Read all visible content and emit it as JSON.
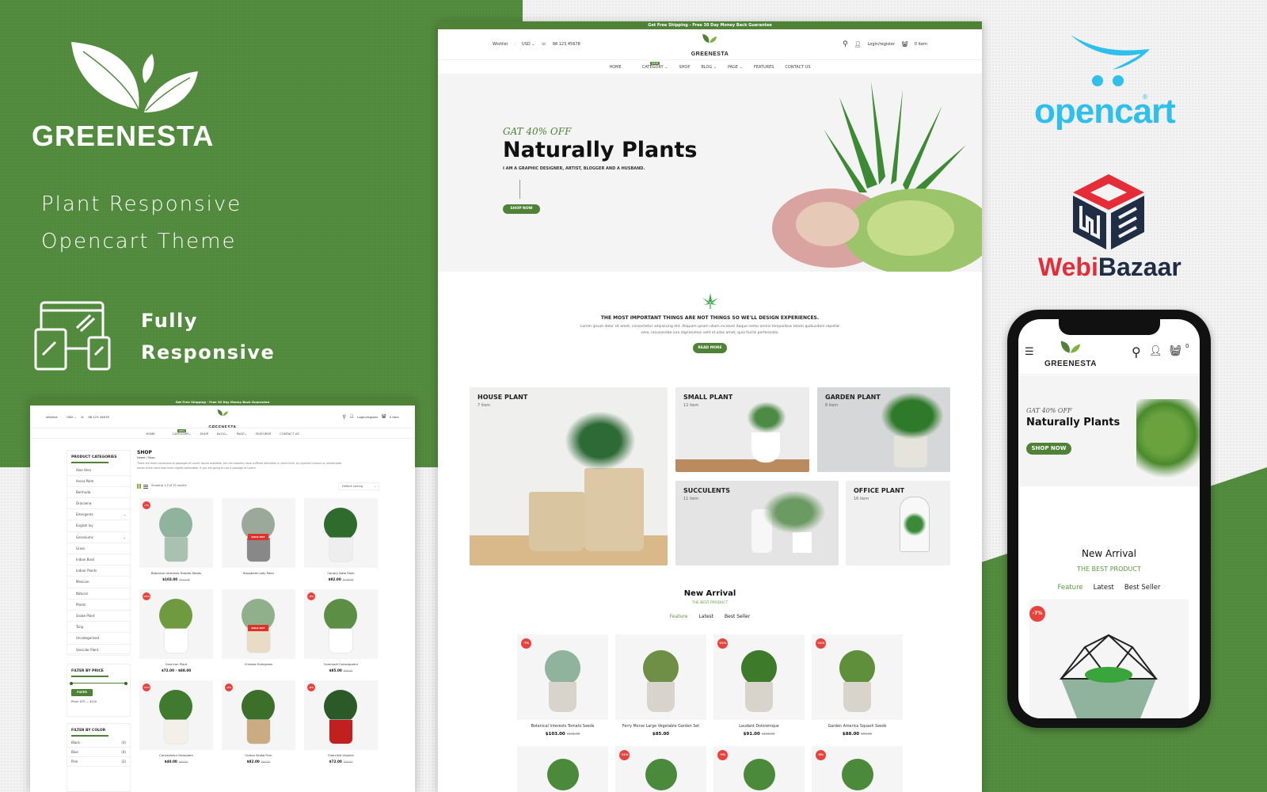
{
  "colors": {
    "brand_green": "#548c3f",
    "accent_green": "#4f8236",
    "discount_red": "#e8423c",
    "opencart_blue": "#2ebfec",
    "webibazaar_red": "#e52d3a",
    "webibazaar_navy": "#1f2d45"
  },
  "promo": {
    "brand_name": "GREENESTA",
    "tagline_line1": "Plant Responsive",
    "tagline_line2": "Opencart Theme",
    "feature_line1": "Fully",
    "feature_line2": "Responsive",
    "feature_icon": "responsive-devices-icon"
  },
  "partners": {
    "opencart_label": "opencart",
    "opencart_reg": "®",
    "webibazaar_part1": "Webi",
    "webibazaar_part2": "Bazaar"
  },
  "desktop": {
    "promo_bar": "Get Free Shipping - Free 30 Day Money Back Guarantee",
    "header": {
      "wishlist": "Wishlist",
      "currency": "USD",
      "phone": "98 123 45678",
      "logo": "GREENESTA",
      "login": "Login/register",
      "cart": "0 item"
    },
    "nav": [
      {
        "label": "HOME"
      },
      {
        "label": "CATEGORY",
        "dropdown": true,
        "badge": "NEW"
      },
      {
        "label": "SHOP"
      },
      {
        "label": "BLOG",
        "dropdown": true
      },
      {
        "label": "PAGE",
        "dropdown": true
      },
      {
        "label": "FEATURES"
      },
      {
        "label": "CONTACT US"
      }
    ],
    "hero": {
      "kicker": "GAT 40% OFF",
      "title": "Naturally Plants",
      "subtitle": "I AM A GRAPHIC DESIGNER, ARTIST, BLOGGER AND A HUSBAND.",
      "button": "SHOP NOW"
    },
    "about": {
      "heading": "THE MOST IMPORTANT THINGS ARE NOT THINGS SO WE'LL DESIGN EXPERIENCES.",
      "text_line1": "Lorem ipsum dolor sit amet, consectetur adipisicing elit. Aliquam ipsam ullam incidunt itaque nemo omnis temporibus totam quibusdam repellat",
      "text_line2": "vero, recusandae iure dignissimos velit et alias amet, quia facilis perferendis.",
      "button": "READ MORE"
    },
    "categories": [
      {
        "name": "HOUSE PLANT",
        "count": "7 item"
      },
      {
        "name": "SMALL PLANT",
        "count": "12 item"
      },
      {
        "name": "GARDEN PLANT",
        "count": "8 item"
      },
      {
        "name": "SUCCULENTS",
        "count": "11 item"
      },
      {
        "name": "OFFICE PLANT",
        "count": "16 item"
      }
    ],
    "new_arrival": {
      "title": "New Arrival",
      "subtitle": "THE BEST PRODUCT",
      "tabs": [
        {
          "label": "Feature",
          "active": true
        },
        {
          "label": "Latest"
        },
        {
          "label": "Best Seller"
        }
      ],
      "products": [
        {
          "name": "Botanical Interests Tomato Seeds",
          "price": "$103.00",
          "old_price": "$111.00",
          "discount": "-7%"
        },
        {
          "name": "Ferry Morse Large Vegetable Garden Set",
          "price": "$85.00",
          "old_price": "",
          "discount": ""
        },
        {
          "name": "Laudant Doloremque",
          "price": "$91.00",
          "old_price": "$116.00",
          "discount": "-21%"
        },
        {
          "name": "Garden America Squash Seeds",
          "price": "$88.00",
          "old_price": "$99.00",
          "discount": "-11%"
        }
      ],
      "row2_discounts": [
        "",
        "-11%",
        "-9%",
        "-6%"
      ]
    }
  },
  "shop_screen": {
    "promo_bar": "Get Free Shipping - Free 30 Day Money Back Guarantee",
    "header": {
      "wishlist": "Wishlist",
      "currency": "USD",
      "phone": "98 123 45678",
      "logo": "GREENESTA",
      "login": "Login/register",
      "cart": "0 item"
    },
    "nav": [
      "HOME",
      "CATEGORY",
      "SHOP",
      "BLOG",
      "PAGE",
      "FEATURES",
      "CONTACT US"
    ],
    "nav_badge": "NEW",
    "title": "SHOP",
    "breadcrumb": "Home / Shop",
    "description_line1": "There are many variations of passages of Lorem Ipsum available, but the majority have suffered alteration in some form, by injected humour or randomised",
    "description_line2": "words which dont look even slightly believable. If you are going to use a passage of Lorem.",
    "results": "Showing 1-9 of 20 results",
    "sort": "Default sorting",
    "categories_title": "PRODUCT CATEGORIES",
    "categories": [
      {
        "label": "Aloe Vera"
      },
      {
        "label": "Areca Palm"
      },
      {
        "label": "Bermuda"
      },
      {
        "label": "Dracaena"
      },
      {
        "label": "Emergents",
        "expandable": true
      },
      {
        "label": "English Ivy"
      },
      {
        "label": "Geraniums",
        "expandable": true
      },
      {
        "label": "Grass"
      },
      {
        "label": "Indian Basil"
      },
      {
        "label": "Indoor Plants"
      },
      {
        "label": "Mexican"
      },
      {
        "label": "Natural"
      },
      {
        "label": "Plants"
      },
      {
        "label": "Snake Plant"
      },
      {
        "label": "Tulip"
      },
      {
        "label": "Uncategorized"
      },
      {
        "label": "Vascular Plant"
      }
    ],
    "price_filter": {
      "title": "FILTER BY PRICE",
      "button": "FILTER",
      "label": "Price: $70 — $110",
      "range_min_fraction": 0,
      "range_max_fraction": 1
    },
    "color_filter": {
      "title": "FILTER BY COLOR",
      "items": [
        {
          "label": "Black",
          "count": "(3)"
        },
        {
          "label": "Blue",
          "count": "(4)"
        },
        {
          "label": "Pink",
          "count": "(2)"
        }
      ]
    },
    "products": [
      {
        "name": "Botanical Interests Tomato Seeds",
        "price": "$103.00",
        "old_price": "$111.00",
        "discount": "-7%",
        "sold_out": ""
      },
      {
        "name": "Broadleaf Lady Palm",
        "price": "",
        "old_price": "",
        "discount": "",
        "sold_out": "SOLD OUT"
      },
      {
        "name": "Canary Date Palm",
        "price": "$92.00",
        "old_price": "$116.00",
        "discount": "",
        "sold_out": ""
      },
      {
        "name": "Cast Iron Plant",
        "price": "$72.00 – $88.00",
        "old_price": "",
        "discount": "-11%",
        "sold_out": ""
      },
      {
        "name": "Chinese Evergreen",
        "price": "",
        "old_price": "",
        "discount": "",
        "sold_out": "SOLD OUT"
      },
      {
        "name": "Commodi Consequatur",
        "price": "$85.00",
        "old_price": "$88.00",
        "discount": "-3%",
        "sold_out": ""
      },
      {
        "name": "Consectetur Hampden",
        "price": "$40.00",
        "old_price": "$45.00",
        "discount": "-11%",
        "sold_out": ""
      },
      {
        "name": "Creton Brake Fern",
        "price": "$82.00",
        "old_price": "$84.00",
        "discount": "-2%",
        "sold_out": ""
      },
      {
        "name": "Exercitat Virginia",
        "price": "$72.00",
        "old_price": "$78.00",
        "discount": "-8%",
        "sold_out": ""
      }
    ]
  },
  "mobile": {
    "logo": "GREENESTA",
    "cart_count": "0",
    "hero": {
      "kicker": "GAT 40% OFF",
      "title": "Naturally Plants",
      "button": "SHOP NOW"
    },
    "new_arrival": {
      "title": "New Arrival",
      "subtitle": "THE BEST PRODUCT",
      "tabs": [
        {
          "label": "Feature",
          "active": true
        },
        {
          "label": "Latest"
        },
        {
          "label": "Best Seller"
        }
      ],
      "first_discount": "-7%"
    }
  }
}
